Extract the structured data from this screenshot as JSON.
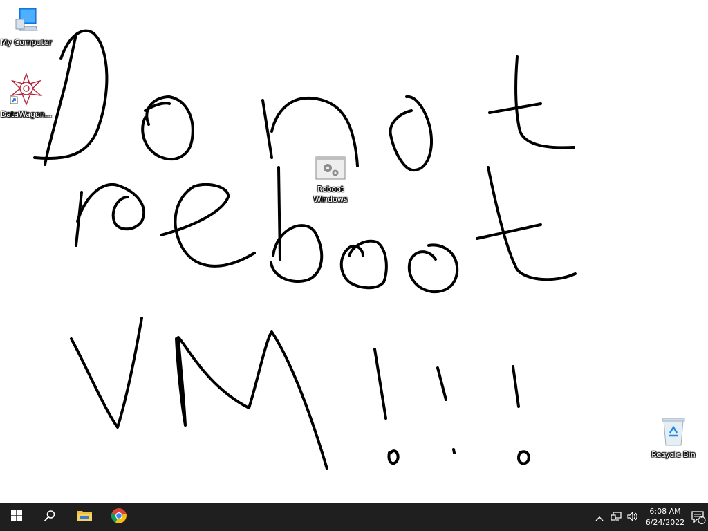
{
  "desktop": {
    "icons": {
      "my_computer": {
        "label": "My Computer",
        "icon": "monitor-icon"
      },
      "datawagon": {
        "label": "DataWagon...",
        "icon": "datawagon-shortcut-icon"
      },
      "reboot": {
        "label": "Reboot Windows",
        "icon": "gears-shortcut-icon"
      },
      "recycle_bin": {
        "label": "Recycle Bin",
        "icon": "recycle-bin-icon"
      }
    },
    "handwriting": "Do not reboot VM!!!"
  },
  "taskbar": {
    "start_icon": "windows-logo-icon",
    "search_icon": "search-icon",
    "pinned": [
      {
        "name": "File Explorer",
        "icon": "folder-icon"
      },
      {
        "name": "Google Chrome",
        "icon": "chrome-icon"
      }
    ],
    "tray": {
      "chevron_icon": "chevron-up-icon",
      "network_icon": "network-icon",
      "volume_icon": "speaker-icon",
      "time": "6:08 AM",
      "date": "6/24/2022",
      "notification_count": "1"
    }
  },
  "colors": {
    "taskbar_bg": "#1f1f1f",
    "desktop_bg": "#ffffff",
    "ink": "#000000"
  }
}
